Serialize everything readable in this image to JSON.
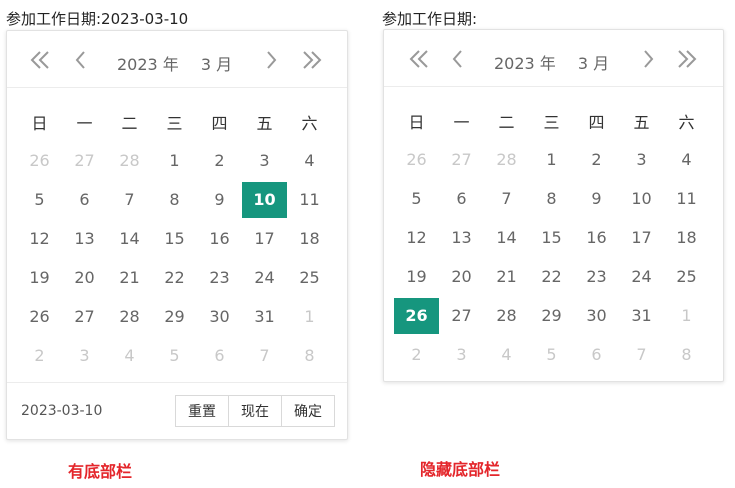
{
  "left": {
    "label": "参加工作日期:2023-03-10",
    "year": "2023 年",
    "month": "3 月",
    "footer_value": "2023-03-10",
    "buttons": [
      "重置",
      "现在",
      "确定"
    ],
    "selected": "10",
    "caption": "有底部栏"
  },
  "right": {
    "label": "参加工作日期:",
    "year": "2023 年",
    "month": "3 月",
    "selected": "26",
    "caption": "隐藏底部栏"
  },
  "weekdays": [
    "日",
    "一",
    "二",
    "三",
    "四",
    "五",
    "六"
  ],
  "weeks": [
    [
      "26",
      "27",
      "28",
      "1",
      "2",
      "3",
      "4"
    ],
    [
      "5",
      "6",
      "7",
      "8",
      "9",
      "10",
      "11"
    ],
    [
      "12",
      "13",
      "14",
      "15",
      "16",
      "17",
      "18"
    ],
    [
      "19",
      "20",
      "21",
      "22",
      "23",
      "24",
      "25"
    ],
    [
      "26",
      "27",
      "28",
      "29",
      "30",
      "31",
      "1"
    ],
    [
      "2",
      "3",
      "4",
      "5",
      "6",
      "7",
      "8"
    ]
  ],
  "colors": {
    "accent": "#16967e",
    "caption": "#e4262b"
  }
}
